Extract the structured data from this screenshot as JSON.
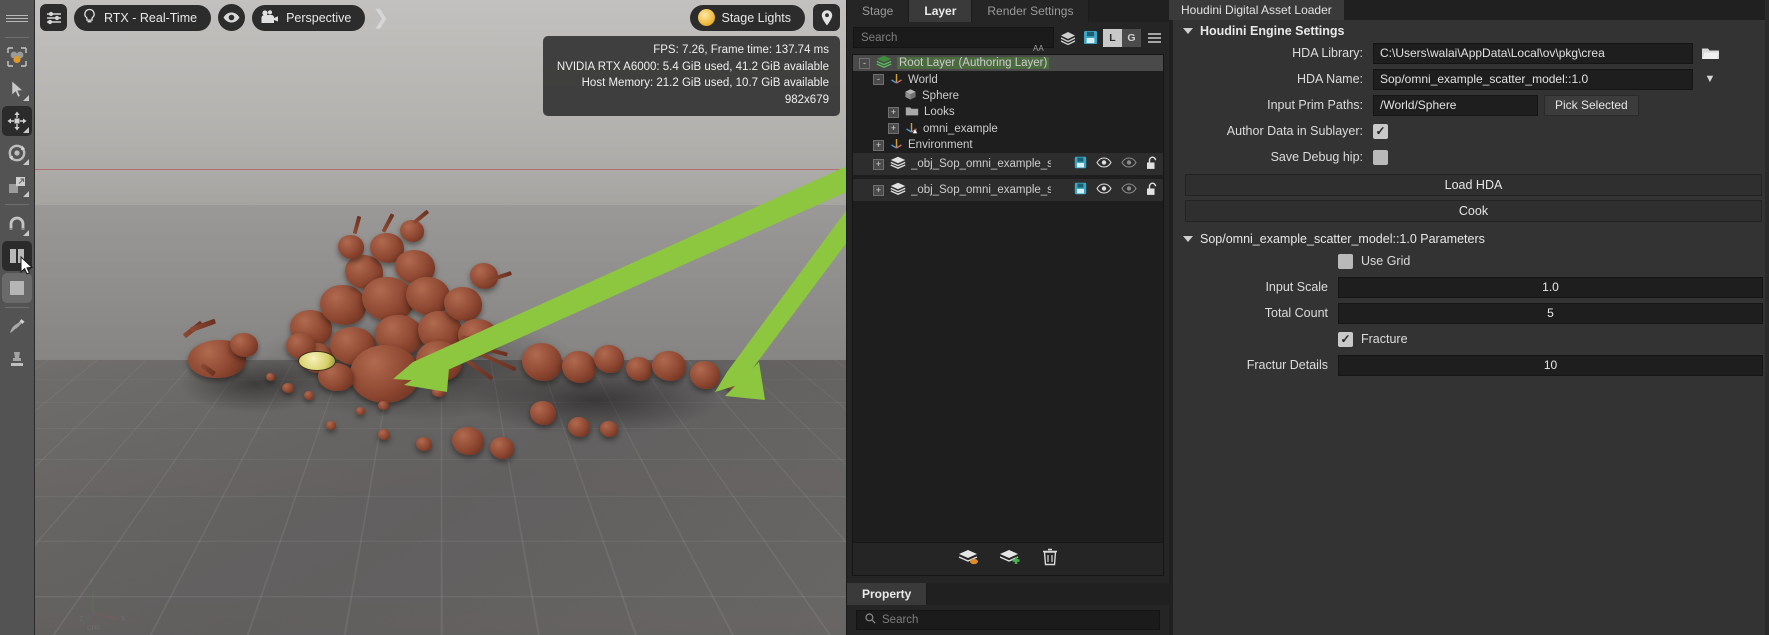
{
  "viewport": {
    "toolbar": {
      "settings_icon": "sliders-icon",
      "render_mode": "RTX - Real-Time",
      "render_mode_icon": "bulb-icon",
      "eye_icon": "eye-icon",
      "camera_label": "Perspective",
      "camera_icon": "camera-icon",
      "expand_icon": "chevron-double-right-icon"
    },
    "topright": {
      "lighting_label": "Stage Lights",
      "lighting_icon": "lamp-icon",
      "pin_icon": "location-pin-icon"
    },
    "hud": {
      "line1": "FPS: 7.26, Frame time: 137.74 ms",
      "line2": "NVIDIA RTX A6000: 5.4 GiB used, 41.2 GiB available",
      "line3": "Host Memory: 21.2 GiB used, 10.7 GiB available",
      "line4": "982x679"
    },
    "axis": {
      "x": "x",
      "y": "y",
      "z": "z",
      "unit": "cm"
    }
  },
  "left_toolbar": {
    "items": [
      {
        "name": "menu-hamburger-icon"
      },
      {
        "name": "select-objects-icon"
      },
      {
        "name": "pointer-select-icon"
      },
      {
        "name": "move-tool-icon"
      },
      {
        "name": "rotate-tool-icon"
      },
      {
        "name": "scale-tool-icon"
      },
      {
        "name": "snap-magnet-icon"
      },
      {
        "name": "columns-layout-icon"
      },
      {
        "name": "single-viewport-icon"
      },
      {
        "name": "paint-brush-icon"
      },
      {
        "name": "stamp-tool-icon"
      }
    ]
  },
  "stage_panel": {
    "tabs": [
      {
        "label": "Stage",
        "active": false
      },
      {
        "label": "Layer",
        "active": true
      },
      {
        "label": "Render Settings",
        "active": false
      }
    ],
    "search_placeholder": "Search",
    "toolbar_icons": [
      "layers-icon",
      "save-layer-icon",
      "local-toggle",
      "global-toggle",
      "menu-icon"
    ],
    "toggle_local": "L",
    "toggle_global": "G",
    "aa_label": "AA",
    "tree": [
      {
        "label": "Root Layer (Authoring Layer)",
        "icon": "layers-icon",
        "indent": 0,
        "expander": "-",
        "selected": true,
        "highlight": true
      },
      {
        "label": "World",
        "icon": "xform-axis-icon",
        "indent": 1,
        "expander": "-",
        "selected": false
      },
      {
        "label": "Sphere",
        "icon": "cube-icon",
        "indent": 2,
        "expander": "",
        "selected": false
      },
      {
        "label": "Looks",
        "icon": "folder-icon",
        "indent": 2,
        "expander": "+",
        "selected": false
      },
      {
        "label": "omni_example",
        "icon": "xform-axis-icon",
        "indent": 2,
        "expander": "+",
        "selected": false
      },
      {
        "label": "Environment",
        "icon": "xform-axis-icon",
        "indent": 1,
        "expander": "+",
        "selected": false
      },
      {
        "label": "_obj_Sop_omni_example_s",
        "icon": "layers-icon",
        "indent": 1,
        "expander": "+",
        "selected": false,
        "band": true,
        "row_icons": true
      },
      {
        "label": "_obj_Sop_omni_example_s",
        "icon": "layers-icon",
        "indent": 1,
        "expander": "+",
        "selected": false,
        "band": true,
        "row_icons": true
      }
    ],
    "footer_icons": [
      "flatten-layers-icon",
      "add-layer-icon",
      "delete-layer-icon"
    ],
    "row_icons": [
      "save-icon",
      "eye-icon",
      "eye-dim-icon",
      "lock-open-icon"
    ]
  },
  "property_panel": {
    "tab_label": "Property",
    "search_placeholder": "Search",
    "search_icon": "search-icon"
  },
  "hda_panel": {
    "title": "Houdini Digital Asset Loader",
    "engine_section": "Houdini Engine Settings",
    "fields": [
      {
        "label": "HDA Library:",
        "value": "C:\\Users\\walai\\AppData\\Local\\ov\\pkg\\crea",
        "type": "text",
        "trailing": "folder-icon"
      },
      {
        "label": "HDA Name:",
        "value": "Sop/omni_example_scatter_model::1.0",
        "type": "text",
        "trailing": "dropdown-icon"
      },
      {
        "label": "Input Prim Paths:",
        "value": "/World/Sphere",
        "type": "text",
        "trailing": "pick",
        "trailing_label": "Pick Selected"
      },
      {
        "label": "Author Data in Sublayer:",
        "value": "",
        "type": "checkbox",
        "checked": true
      },
      {
        "label": "Save Debug hip:",
        "value": "",
        "type": "checkbox",
        "checked": false
      }
    ],
    "buttons": [
      {
        "label": "Load HDA"
      },
      {
        "label": "Cook"
      }
    ],
    "params_section": "Sop/omni_example_scatter_model::1.0 Parameters",
    "params": [
      {
        "label": "Use Grid",
        "type": "checkbox",
        "checked": false,
        "label_after": true
      },
      {
        "label": "Input Scale",
        "type": "number",
        "value": "1.0"
      },
      {
        "label": "Total Count",
        "type": "number",
        "value": "5"
      },
      {
        "label": "Fracture",
        "type": "checkbox",
        "checked": true,
        "label_after": true
      },
      {
        "label": "Fractur Details",
        "type": "number",
        "value": "10"
      }
    ]
  },
  "colors": {
    "accent_green": "#8dc63f",
    "panel_bg": "#333333",
    "dark_bg": "#202020",
    "highlight_green": "#4b6b3f",
    "save_blue": "#3ba7c4"
  }
}
